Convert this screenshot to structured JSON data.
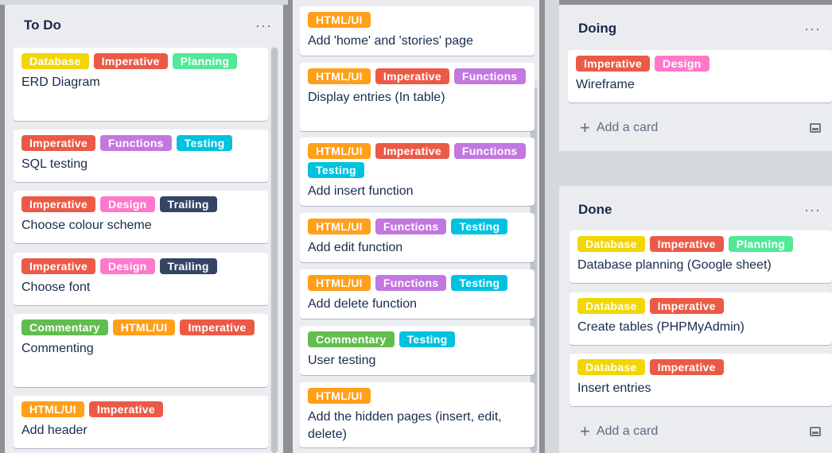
{
  "labels": {
    "Database": {
      "text": "Database",
      "color": "#f2d600"
    },
    "Imperative": {
      "text": "Imperative",
      "color": "#eb5a46"
    },
    "Planning": {
      "text": "Planning",
      "color": "#51e898"
    },
    "Functions": {
      "text": "Functions",
      "color": "#c377e0"
    },
    "Testing": {
      "text": "Testing",
      "color": "#00c2e0"
    },
    "Design": {
      "text": "Design",
      "color": "#ff78cb"
    },
    "Trailing": {
      "text": "Trailing",
      "color": "#344563"
    },
    "Commentary": {
      "text": "Commentary",
      "color": "#61bd4f"
    },
    "HTML/UI": {
      "text": "HTML/UI",
      "color": "#ff9f1a"
    }
  },
  "todo": {
    "title": "To Do",
    "menu": "···",
    "cards": [
      {
        "labels": [
          "Database",
          "Imperative",
          "Planning"
        ],
        "title": "ERD Diagram"
      },
      {
        "labels": [
          "Imperative",
          "Functions",
          "Testing"
        ],
        "title": "SQL testing"
      },
      {
        "labels": [
          "Imperative",
          "Design",
          "Trailing"
        ],
        "title": "Choose colour scheme"
      },
      {
        "labels": [
          "Imperative",
          "Design",
          "Trailing"
        ],
        "title": "Choose font"
      },
      {
        "labels": [
          "Commentary",
          "HTML/UI",
          "Imperative"
        ],
        "title": "Commenting"
      },
      {
        "labels": [
          "HTML/UI",
          "Imperative"
        ],
        "title": "Add header"
      }
    ]
  },
  "todo_cont": {
    "cards": [
      {
        "labels": [
          "HTML/UI"
        ],
        "title": "Add 'home' and 'stories' page"
      },
      {
        "labels": [
          "HTML/UI",
          "Imperative",
          "Functions"
        ],
        "title": "Display entries (In table)"
      },
      {
        "labels": [
          "HTML/UI",
          "Imperative",
          "Functions",
          "Testing"
        ],
        "title": "Add insert function"
      },
      {
        "labels": [
          "HTML/UI",
          "Functions",
          "Testing"
        ],
        "title": "Add edit function"
      },
      {
        "labels": [
          "HTML/UI",
          "Functions",
          "Testing"
        ],
        "title": "Add delete function"
      },
      {
        "labels": [
          "Commentary",
          "Testing"
        ],
        "title": "User testing"
      },
      {
        "labels": [
          "HTML/UI"
        ],
        "title": "Add the hidden pages (insert, edit, delete)"
      }
    ]
  },
  "doing": {
    "title": "Doing",
    "menu": "···",
    "cards": [
      {
        "labels": [
          "Imperative",
          "Design"
        ],
        "title": "Wireframe"
      }
    ],
    "add_card": "Add a card"
  },
  "done": {
    "title": "Done",
    "menu": "···",
    "cards": [
      {
        "labels": [
          "Database",
          "Imperative",
          "Planning"
        ],
        "title": "Database planning (Google sheet)"
      },
      {
        "labels": [
          "Database",
          "Imperative"
        ],
        "title": "Create tables (PHPMyAdmin)"
      },
      {
        "labels": [
          "Database",
          "Imperative"
        ],
        "title": "Insert entries"
      }
    ],
    "add_card": "Add a card"
  }
}
